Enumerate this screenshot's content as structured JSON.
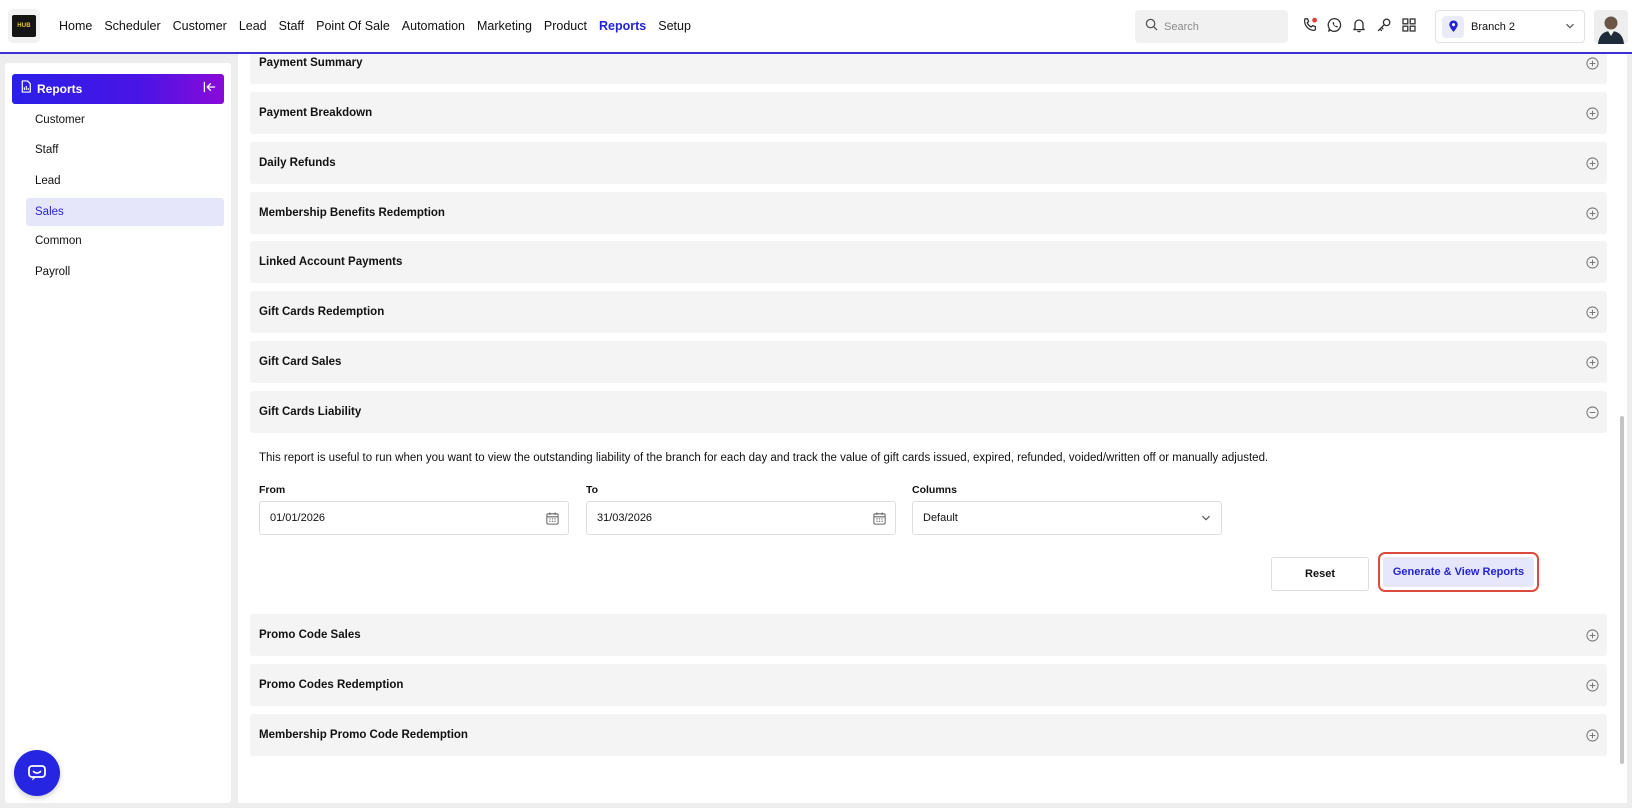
{
  "logo": {
    "text": "HUB"
  },
  "nav": {
    "items": [
      {
        "label": "Home",
        "active": false
      },
      {
        "label": "Scheduler",
        "active": false
      },
      {
        "label": "Customer",
        "active": false
      },
      {
        "label": "Lead",
        "active": false
      },
      {
        "label": "Staff",
        "active": false
      },
      {
        "label": "Point Of Sale",
        "active": false
      },
      {
        "label": "Automation",
        "active": false
      },
      {
        "label": "Marketing",
        "active": false
      },
      {
        "label": "Product",
        "active": false
      },
      {
        "label": "Reports",
        "active": true
      },
      {
        "label": "Setup",
        "active": false
      }
    ]
  },
  "search": {
    "placeholder": "Search"
  },
  "toolbar_icons": [
    "phone-icon",
    "whatsapp-icon",
    "bell-icon",
    "key-icon",
    "apps-grid-icon"
  ],
  "branch": {
    "label": "Branch 2"
  },
  "sidebar": {
    "title": "Reports",
    "items": [
      {
        "label": "Customer",
        "active": false
      },
      {
        "label": "Staff",
        "active": false
      },
      {
        "label": "Lead",
        "active": false
      },
      {
        "label": "Sales",
        "active": true
      },
      {
        "label": "Common",
        "active": false
      },
      {
        "label": "Payroll",
        "active": false
      }
    ]
  },
  "reports": {
    "sections": [
      {
        "title": "Payment Summary",
        "expanded": false
      },
      {
        "title": "Payment Breakdown",
        "expanded": false
      },
      {
        "title": "Daily Refunds",
        "expanded": false
      },
      {
        "title": "Membership Benefits Redemption",
        "expanded": false
      },
      {
        "title": "Linked Account Payments",
        "expanded": false
      },
      {
        "title": "Gift Cards Redemption",
        "expanded": false
      },
      {
        "title": "Gift Card Sales",
        "expanded": false
      },
      {
        "title": "Gift Cards Liability",
        "expanded": true
      },
      {
        "title": "Promo Code Sales",
        "expanded": false
      },
      {
        "title": "Promo Codes Redemption",
        "expanded": false
      },
      {
        "title": "Membership Promo Code Redemption",
        "expanded": false
      }
    ],
    "expanded": {
      "description": "This report is useful to run when you want to view the outstanding liability of the branch for each day and track the value of gift cards issued, expired, refunded, voided/written off or manually adjusted.",
      "from_label": "From",
      "from_value": "01/01/2026",
      "to_label": "To",
      "to_value": "31/03/2026",
      "columns_label": "Columns",
      "columns_value": "Default",
      "reset_label": "Reset",
      "generate_label": "Generate & View Reports"
    }
  },
  "colors": {
    "accent": "#2323d6",
    "header_gradient_start": "#2a1fe8",
    "header_gradient_end": "#8a0ad8",
    "highlight_border": "#dc4b3e",
    "active_bg": "#e6e6fb"
  }
}
